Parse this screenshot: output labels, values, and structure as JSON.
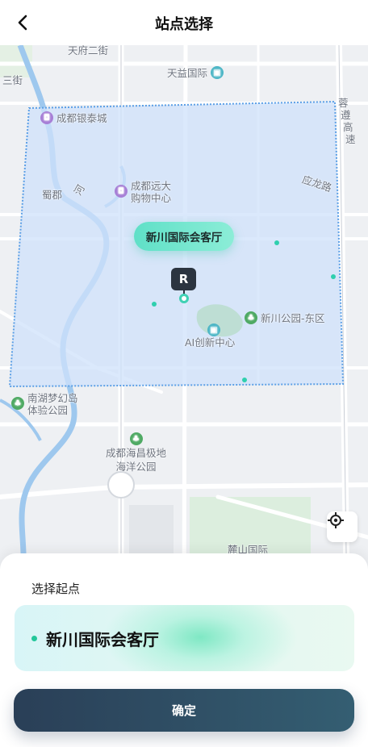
{
  "header": {
    "title": "站点选择",
    "back_icon": "chevron-left-icon"
  },
  "map": {
    "labels": {
      "tianfu_2nd_street": "天府二街",
      "san_jie": "三街",
      "tianyi_intl": "天益国际",
      "yinhetai": "成都银泰城",
      "yuanda": "成都远大",
      "yuanda_2": "购物中心",
      "shu_jun": "蜀郡",
      "he": "河",
      "yinglong_road": "应龙路",
      "expressway_1": "蓉",
      "expressway_2": "遵",
      "expressway_3": "高",
      "expressway_4": "速",
      "xinchuan_park": "新川公园-东区",
      "ai_center": "AI创新中心",
      "nanhu_1": "南湖梦幻岛",
      "nanhu_2": "体验公园",
      "haichang_1": "成都海昌极地",
      "haichang_2": "海洋公园",
      "luchuan": "麓山国际"
    },
    "station_bubble": "新川国际会客厅",
    "pin_letter": "R",
    "colors": {
      "zone_fill": "#cfe2fb",
      "zone_border": "#5b9fe6",
      "accent": "#3fd1b4"
    }
  },
  "sheet": {
    "label": "选择起点",
    "selected_station": "新川国际会客厅",
    "confirm": "确定"
  }
}
